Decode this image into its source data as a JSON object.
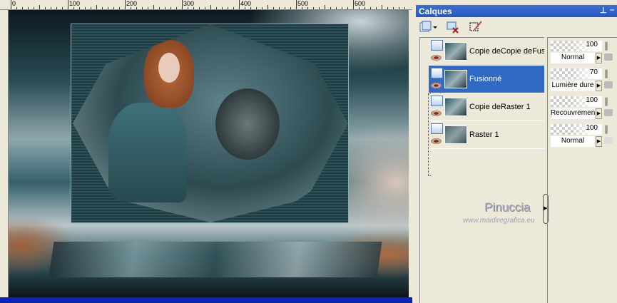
{
  "ruler": {
    "top_labels": [
      "0",
      "100",
      "200",
      "300",
      "400",
      "500",
      "600"
    ]
  },
  "palette": {
    "title": "Calques",
    "toolbar": [
      {
        "icon": "new-layer-icon"
      },
      {
        "icon": "delete-layer-icon"
      },
      {
        "icon": "edit-selection-icon"
      }
    ],
    "layers": [
      {
        "name": "Copie deCopie deFusionné",
        "opacity": "100",
        "blend_mode": "Normal",
        "selected": false
      },
      {
        "name": "Fusionné",
        "opacity": "70",
        "blend_mode": "Lumière dure",
        "selected": true
      },
      {
        "name": "Copie deRaster 1",
        "opacity": "100",
        "blend_mode": "Recouvrement",
        "selected": false
      },
      {
        "name": "Raster 1",
        "opacity": "100",
        "blend_mode": "Normal",
        "selected": false
      }
    ],
    "selected_color": "#316ac5"
  },
  "watermark": {
    "name": "Pinuccia",
    "url": "www.maidiregrafica.eu"
  }
}
